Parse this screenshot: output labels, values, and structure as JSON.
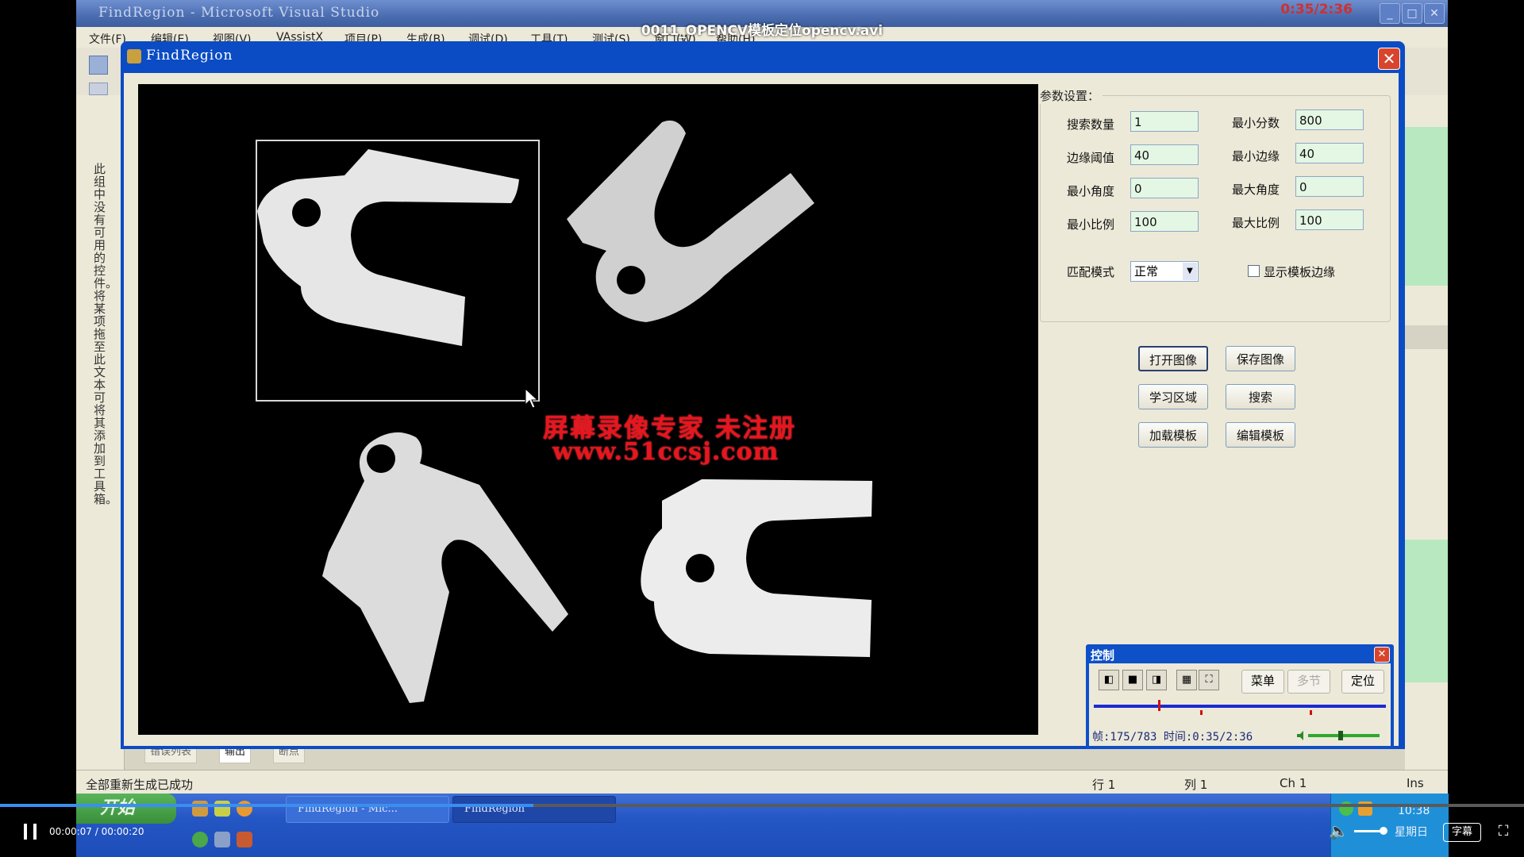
{
  "video": {
    "title": "0011_OPENCV模板定位opencv.avi",
    "time": "00:00:07 / 00:00:20",
    "progress": 0.35,
    "subtitle_label": "字幕"
  },
  "vs": {
    "title": "FindRegion - Microsoft Visual Studio",
    "clock": "0:35/2:36",
    "menu": [
      "文件(F)",
      "编辑(E)",
      "视图(V)",
      "VAssistX",
      "项目(P)",
      "生成(B)",
      "调试(D)",
      "工具(T)",
      "测试(S)",
      "窗口(W)",
      "帮助(H)"
    ],
    "toolbox_text": "此组中没有可用的控件。将某项拖至此文本可将其添加到工具箱。",
    "status": {
      "message": "全部重新生成已成功",
      "row": "行 1",
      "col": "列 1",
      "ch": "Ch 1",
      "ins": "Ins"
    },
    "bottom_tabs": [
      "错误列表",
      "输出",
      "断点"
    ]
  },
  "taskbar": {
    "start": "开始",
    "tasks": [
      "FindRegion - Mic...",
      "FindRegion"
    ],
    "time": "10:38",
    "day": "星期日"
  },
  "dialog": {
    "title": "FindRegion",
    "params": {
      "legend": "参数设置：",
      "search_count_label": "搜索数量",
      "search_count": "1",
      "min_score_label": "最小分数",
      "min_score": "800",
      "edge_threshold_label": "边缘阈值",
      "edge_threshold": "40",
      "min_edge_label": "最小边缘",
      "min_edge": "40",
      "min_angle_label": "最小角度",
      "min_angle": "0",
      "max_angle_label": "最大角度",
      "max_angle": "0",
      "min_scale_label": "最小比例",
      "min_scale": "100",
      "max_scale_label": "最大比例",
      "max_scale": "100",
      "match_mode_label": "匹配模式",
      "match_mode": "正常",
      "show_edges_label": "显示模板边缘"
    },
    "buttons": {
      "open_image": "打开图像",
      "save_image": "保存图像",
      "learn_region": "学习区域",
      "search": "搜索",
      "load_template": "加载模板",
      "edit_template": "编辑模板"
    },
    "watermark": {
      "line1": "屏幕录像专家 未注册",
      "line2": "www.51ccsj.com"
    }
  },
  "recorder": {
    "title": "控制",
    "menu_btn": "菜单",
    "multi_btn": "多节",
    "locate_btn": "定位",
    "info": "帧:175/783 时间:0:35/2:36",
    "position": 0.22
  }
}
